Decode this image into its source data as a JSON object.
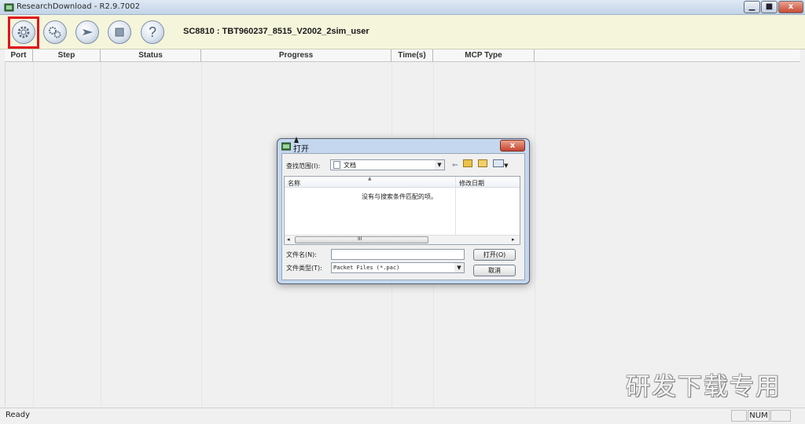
{
  "window": {
    "title": "ResearchDownload - R2.9.7002",
    "minimize": "▁",
    "maximize": "■",
    "close": "x"
  },
  "toolbar": {
    "buttons": [
      {
        "icon": "gear-icon"
      },
      {
        "icon": "gears-icon"
      },
      {
        "icon": "play-arrow-icon"
      },
      {
        "icon": "stop-icon"
      },
      {
        "icon": "help-icon",
        "glyph": "?"
      }
    ],
    "model": "SC8810 : TBT960237_8515_V2002_2sim_user"
  },
  "grid": {
    "columns": [
      "Port",
      "Step",
      "Status",
      "Progress",
      "Time(s)",
      "MCP Type"
    ]
  },
  "statusbar": {
    "text": "Ready",
    "num": "NUM"
  },
  "dialog": {
    "title": "打开",
    "close": "x",
    "look_in_label": "查找范围(I):",
    "look_in_value": "文档",
    "list_columns": [
      "名称",
      "修改日期"
    ],
    "empty_message": "没有与搜索条件匹配的项。",
    "scroll_grip": "III",
    "scroll_left": "◂",
    "scroll_right": "▸",
    "filename_label": "文件名(N):",
    "filename_value": "",
    "filetype_label": "文件类型(T):",
    "filetype_value": "Packet Files (*.pac)",
    "open_button": "打开(O)",
    "cancel_button": "取消"
  },
  "watermark": "研发下载专用"
}
